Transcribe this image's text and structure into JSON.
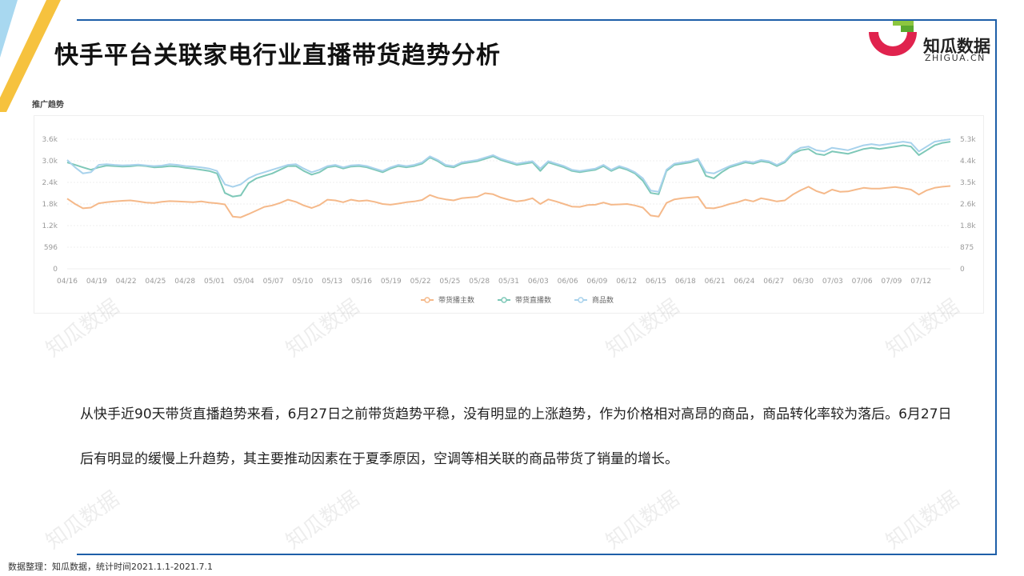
{
  "title": "快手平台关联家电行业直播带货趋势分析",
  "logo": {
    "cn": "知瓜数据",
    "en": "ZHIGUA.CN"
  },
  "chart_label": "推广趋势",
  "paragraph": "从快手近90天带货直播趋势来看，6月27日之前带货趋势平稳，没有明显的上涨趋势，作为价格相对高昂的商品，商品转化率较为落后。6月27日后有明显的缓慢上升趋势，其主要推动因素在于夏季原因，空调等相关联的商品带货了销量的增长。",
  "footer": "数据整理：知瓜数据，统计时间2021.1.1-2021.7.1",
  "watermark": "知瓜数据",
  "colors": {
    "frame": "#1e5fa8",
    "series_orange": "#f5b98a",
    "series_green": "#7ec8b8",
    "series_blue": "#a8d2ec"
  },
  "chart_data": {
    "type": "line",
    "title": "推广趋势",
    "x_ticks": [
      "04/16",
      "04/19",
      "04/22",
      "04/25",
      "04/28",
      "05/01",
      "05/04",
      "05/07",
      "05/10",
      "05/13",
      "05/16",
      "05/19",
      "05/22",
      "05/25",
      "05/28",
      "05/31",
      "06/03",
      "06/06",
      "06/09",
      "06/12",
      "06/15",
      "06/18",
      "06/21",
      "06/24",
      "06/27",
      "06/30",
      "07/03",
      "07/06",
      "07/09",
      "07/12"
    ],
    "y_left_ticks": [
      "0",
      "596",
      "1.2k",
      "1.8k",
      "2.4k",
      "3.0k",
      "3.6k"
    ],
    "y_right_ticks": [
      "0",
      "875",
      "1.8k",
      "2.6k",
      "3.5k",
      "4.4k",
      "5.3k"
    ],
    "y_left_range": [
      0,
      3600
    ],
    "y_right_range": [
      0,
      5300
    ],
    "legend_position": "bottom-center",
    "series": [
      {
        "name": "带货播主数",
        "axis": "left",
        "color": "#f5b98a",
        "values": [
          1950,
          1800,
          1680,
          1700,
          1820,
          1850,
          1870,
          1890,
          1900,
          1870,
          1840,
          1830,
          1860,
          1880,
          1870,
          1860,
          1850,
          1870,
          1840,
          1820,
          1790,
          1450,
          1430,
          1520,
          1620,
          1720,
          1760,
          1830,
          1920,
          1860,
          1760,
          1690,
          1770,
          1920,
          1900,
          1850,
          1920,
          1880,
          1900,
          1860,
          1800,
          1780,
          1810,
          1850,
          1870,
          1910,
          2050,
          1970,
          1930,
          1900,
          1960,
          1980,
          2000,
          2100,
          2070,
          1980,
          1920,
          1870,
          1900,
          1960,
          1800,
          1930,
          1870,
          1800,
          1730,
          1720,
          1770,
          1780,
          1840,
          1780,
          1790,
          1800,
          1760,
          1700,
          1480,
          1450,
          1830,
          1930,
          1960,
          1980,
          2000,
          1690,
          1680,
          1730,
          1800,
          1850,
          1920,
          1870,
          1960,
          1920,
          1870,
          1900,
          2060,
          2180,
          2280,
          2160,
          2090,
          2200,
          2140,
          2150,
          2200,
          2250,
          2230,
          2230,
          2250,
          2270,
          2240,
          2200,
          2060,
          2180,
          2250,
          2280,
          2300
        ]
      },
      {
        "name": "带货直播数",
        "axis": "right",
        "color": "#7ec8b8",
        "values": [
          4350,
          4250,
          4150,
          4050,
          4150,
          4220,
          4200,
          4180,
          4190,
          4230,
          4200,
          4150,
          4160,
          4200,
          4180,
          4130,
          4100,
          4050,
          4000,
          3900,
          3100,
          2950,
          3000,
          3500,
          3700,
          3800,
          3900,
          4050,
          4200,
          4200,
          4000,
          3850,
          3950,
          4150,
          4200,
          4100,
          4180,
          4200,
          4150,
          4050,
          3950,
          4100,
          4200,
          4150,
          4200,
          4300,
          4550,
          4400,
          4200,
          4150,
          4300,
          4350,
          4400,
          4500,
          4600,
          4450,
          4350,
          4250,
          4300,
          4350,
          4000,
          4350,
          4250,
          4150,
          4000,
          3950,
          4000,
          4050,
          4200,
          4000,
          4150,
          4050,
          3900,
          3600,
          3100,
          3050,
          4000,
          4250,
          4300,
          4350,
          4450,
          3800,
          3700,
          3950,
          4150,
          4250,
          4350,
          4300,
          4400,
          4350,
          4200,
          4350,
          4700,
          4850,
          4900,
          4700,
          4650,
          4800,
          4750,
          4700,
          4800,
          4900,
          4950,
          4900,
          4950,
          5000,
          5050,
          5000,
          4650,
          4850,
          5050,
          5150,
          5200
        ]
      },
      {
        "name": "商品数",
        "axis": "right",
        "color": "#a8d2ec",
        "values": [
          4450,
          4150,
          3900,
          3950,
          4250,
          4280,
          4250,
          4230,
          4240,
          4260,
          4230,
          4200,
          4220,
          4280,
          4250,
          4200,
          4180,
          4150,
          4100,
          4000,
          3450,
          3350,
          3450,
          3700,
          3850,
          3950,
          4050,
          4150,
          4250,
          4280,
          4100,
          3950,
          4050,
          4200,
          4250,
          4150,
          4230,
          4250,
          4200,
          4100,
          4000,
          4150,
          4250,
          4200,
          4250,
          4350,
          4600,
          4450,
          4250,
          4200,
          4350,
          4400,
          4450,
          4550,
          4650,
          4500,
          4400,
          4300,
          4350,
          4400,
          4100,
          4400,
          4300,
          4200,
          4050,
          4000,
          4050,
          4100,
          4250,
          4050,
          4200,
          4100,
          3950,
          3700,
          3200,
          3150,
          4050,
          4300,
          4350,
          4400,
          4500,
          3950,
          3900,
          4050,
          4200,
          4300,
          4400,
          4350,
          4450,
          4400,
          4250,
          4400,
          4750,
          4950,
          5000,
          4850,
          4800,
          4950,
          4900,
          4850,
          4950,
          5050,
          5100,
          5050,
          5100,
          5150,
          5200,
          5150,
          4800,
          5000,
          5200,
          5250,
          5300
        ]
      }
    ]
  }
}
